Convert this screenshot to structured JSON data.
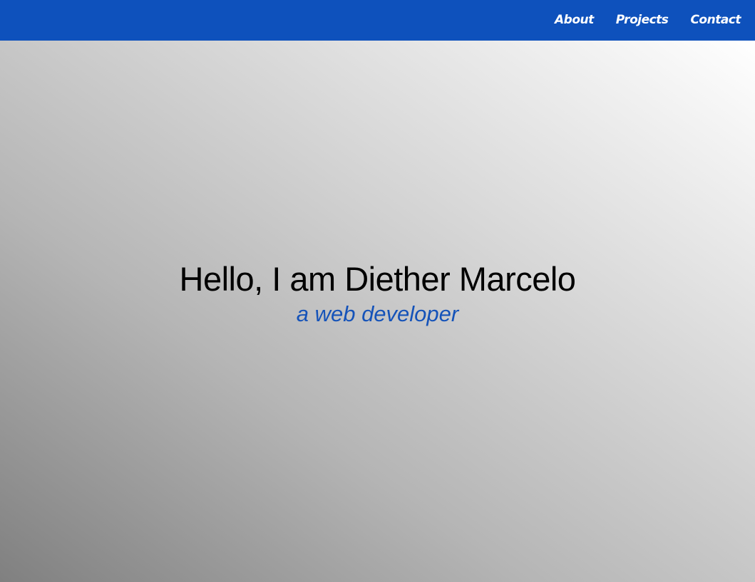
{
  "nav": {
    "background": "#0e51bc",
    "items": [
      {
        "label": "About"
      },
      {
        "label": "Projects"
      },
      {
        "label": "Contact"
      }
    ]
  },
  "hero": {
    "title": "Hello, I am Diether Marcelo",
    "subtitle": "a web developer",
    "subtitle_color": "#1553b9"
  }
}
